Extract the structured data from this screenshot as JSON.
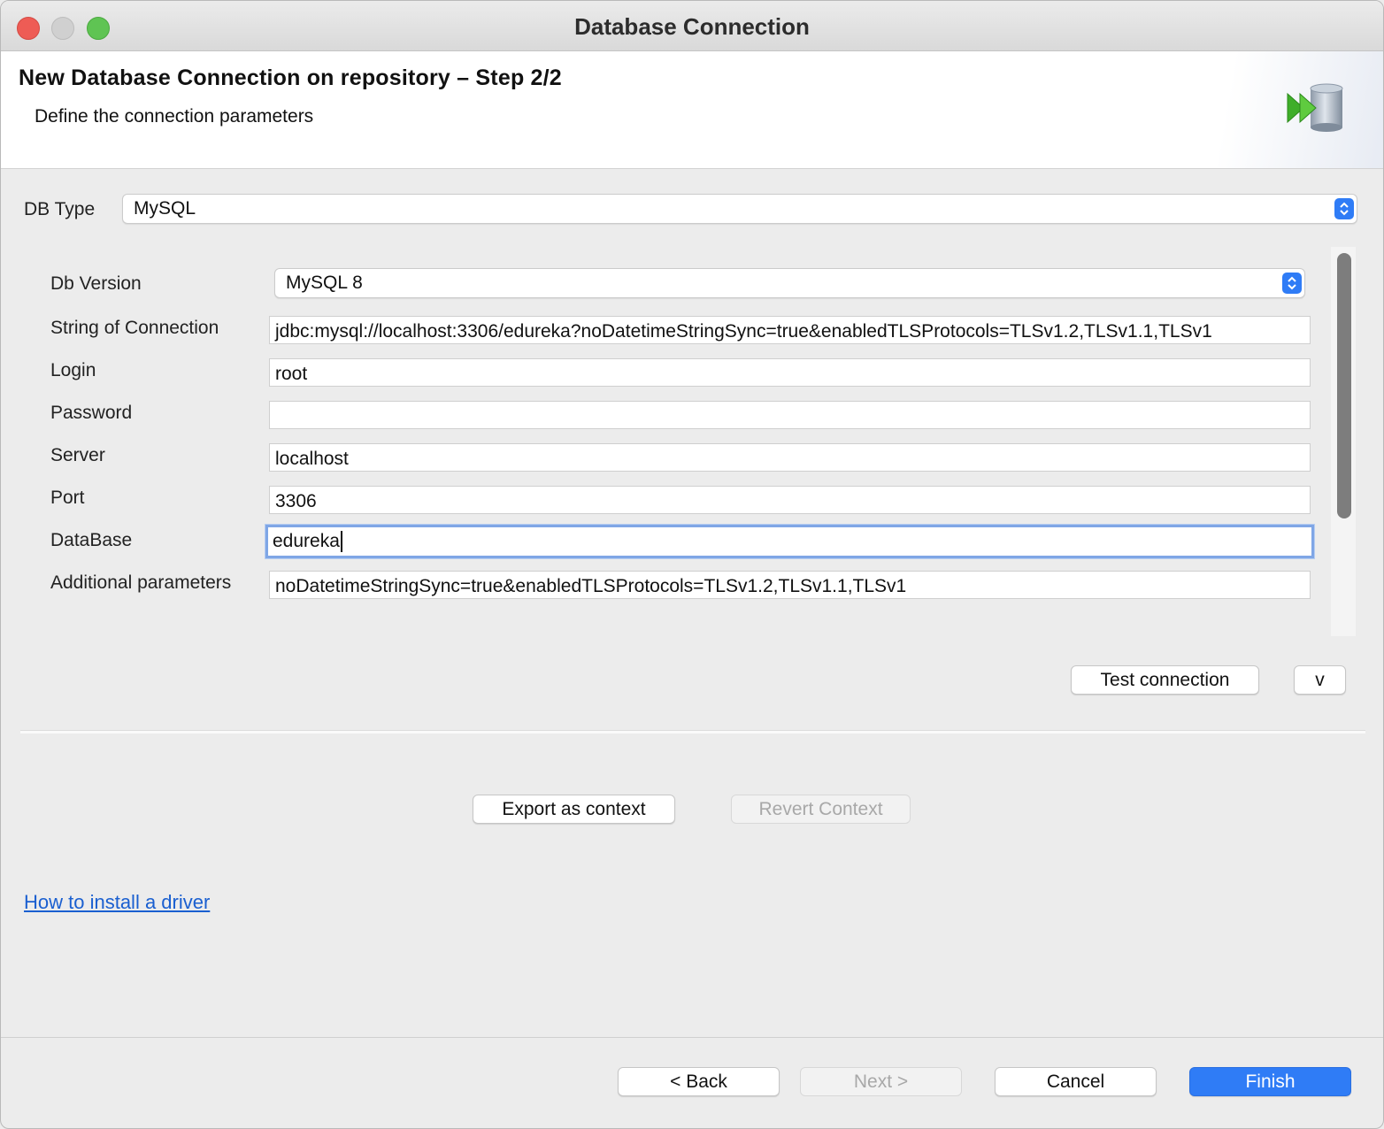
{
  "window": {
    "title": "Database Connection"
  },
  "header": {
    "title": "New Database Connection on repository – Step 2/2",
    "subtitle": "Define the connection parameters",
    "icon": "database-connection-icon"
  },
  "db_type": {
    "label": "DB Type",
    "value": "MySQL"
  },
  "form": {
    "db_version": {
      "label": "Db Version",
      "value": "MySQL 8"
    },
    "connection_string": {
      "label": "String of Connection",
      "value": "jdbc:mysql://localhost:3306/edureka?noDatetimeStringSync=true&enabledTLSProtocols=TLSv1.2,TLSv1.1,TLSv1"
    },
    "login": {
      "label": "Login",
      "value": "root"
    },
    "password": {
      "label": "Password",
      "value": ""
    },
    "server": {
      "label": "Server",
      "value": "localhost"
    },
    "port": {
      "label": "Port",
      "value": "3306"
    },
    "database": {
      "label": "DataBase",
      "value": "edureka"
    },
    "additional_parameters": {
      "label": "Additional parameters",
      "value": "noDatetimeStringSync=true&enabledTLSProtocols=TLSv1.2,TLSv1.1,TLSv1"
    }
  },
  "actions": {
    "test_connection": "Test connection",
    "expand": "v",
    "export_context": "Export as context",
    "revert_context": "Revert Context"
  },
  "help_link": "How to install a driver",
  "footer": {
    "back": "< Back",
    "next": "Next >",
    "cancel": "Cancel",
    "finish": "Finish"
  },
  "colors": {
    "accent": "#2f7cf6",
    "link": "#1a5fd0",
    "focus_ring": "#7fa6e6"
  }
}
